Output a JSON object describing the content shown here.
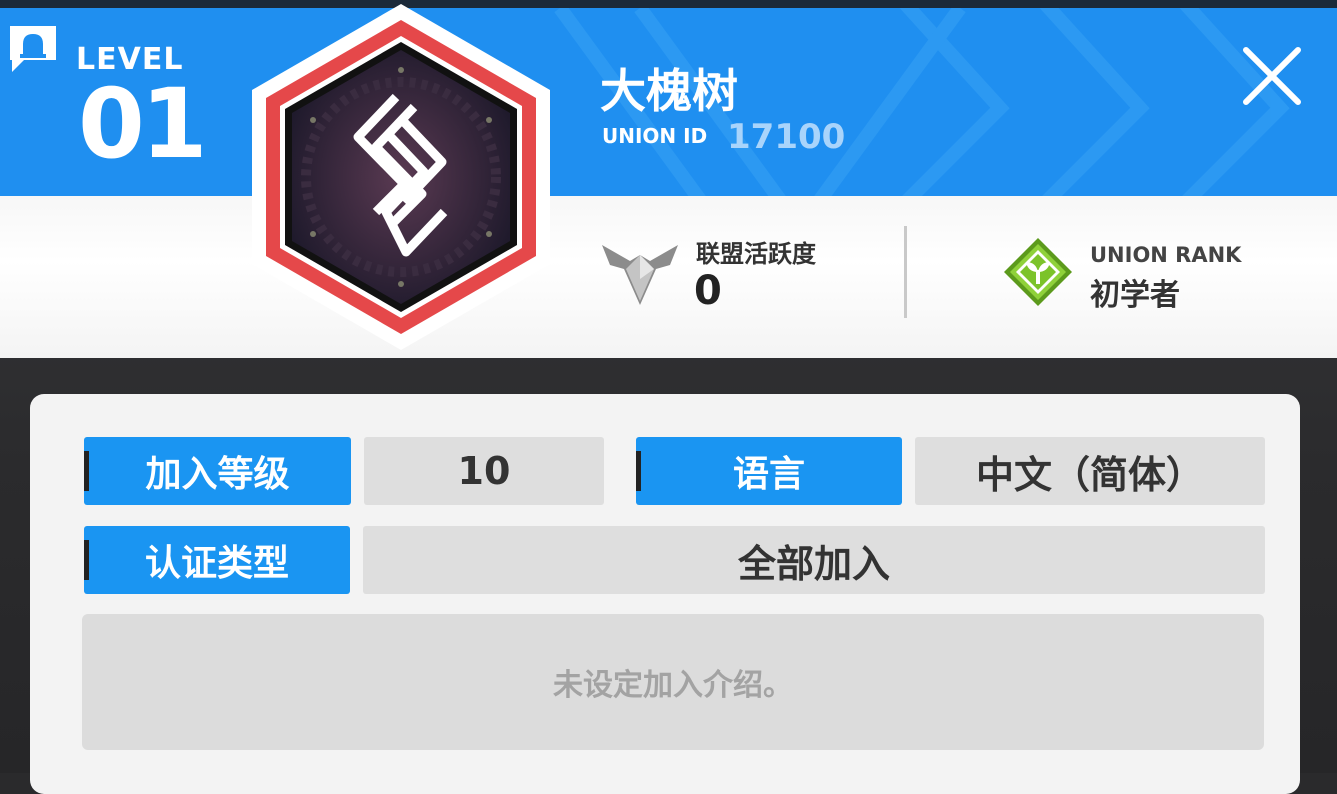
{
  "header": {
    "level_label": "LEVEL",
    "level_value": "01",
    "union_name": "大槐树",
    "union_id_label": "UNION ID",
    "union_id_value": "17100"
  },
  "stats": {
    "activity_label": "联盟活跃度",
    "activity_value": "0",
    "rank_label": "UNION RANK",
    "rank_value": "初学者"
  },
  "info": {
    "join_level_label": "加入等级",
    "join_level_value": "10",
    "language_label": "语言",
    "language_value": "中文（简体）",
    "auth_type_label": "认证类型",
    "auth_type_value": "全部加入",
    "intro_text": "未设定加入介绍。"
  },
  "icons": {
    "notice": "notice-icon",
    "close": "close-icon",
    "emblem": "union-emblem-icon",
    "activity": "activity-wings-icon",
    "rank": "rank-sprout-icon"
  },
  "colors": {
    "header_blue": "#1f8ff0",
    "chip_blue": "#1a95f2",
    "emblem_red": "#e5484a",
    "rank_green": "#7cc32a"
  }
}
